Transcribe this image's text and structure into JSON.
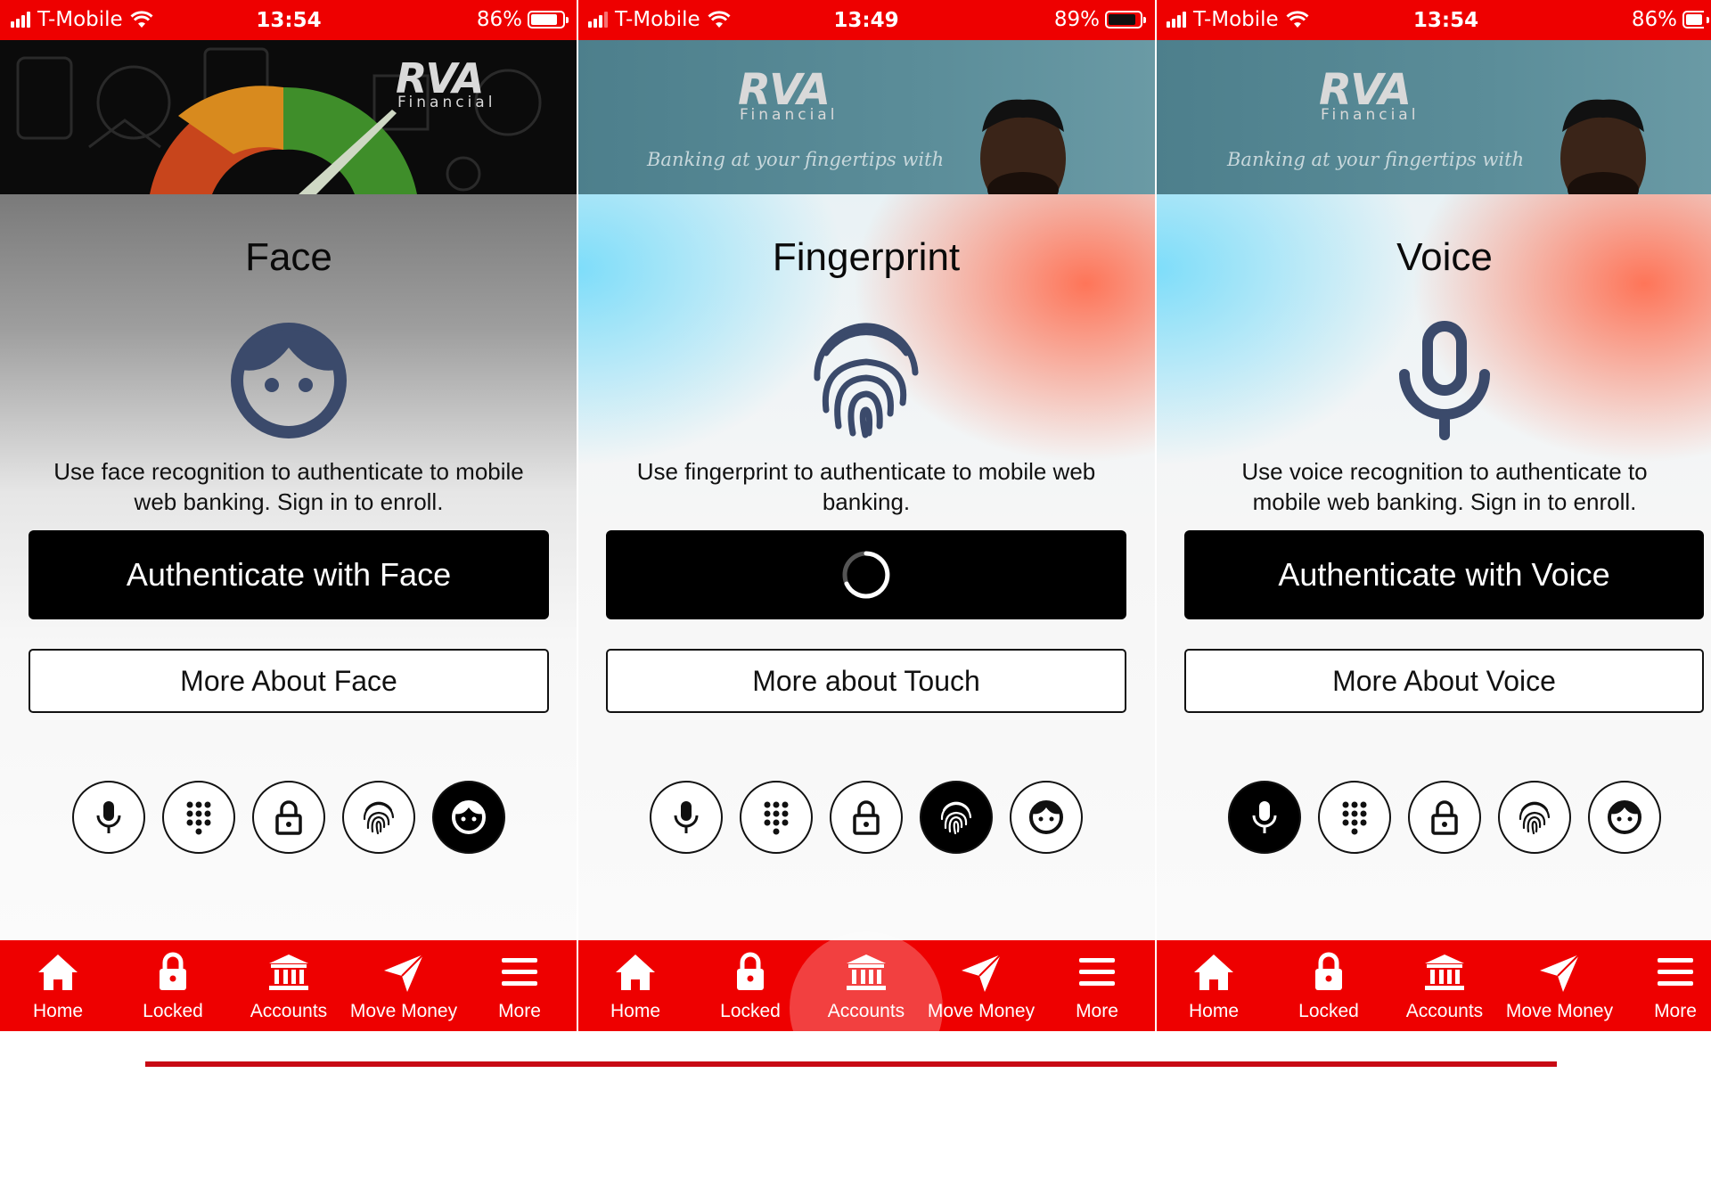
{
  "colors": {
    "brand_red": "#ee0000",
    "icon_navy": "#3b4a6b",
    "divider": "#c80a14"
  },
  "tabs": [
    {
      "label": "Home",
      "icon": "home-icon"
    },
    {
      "label": "Locked",
      "icon": "lock-icon"
    },
    {
      "label": "Accounts",
      "icon": "bank-icon"
    },
    {
      "label": "Move Money",
      "icon": "paper-plane-icon"
    },
    {
      "label": "More",
      "icon": "menu-icon"
    }
  ],
  "phones": [
    {
      "status": {
        "carrier": "T-Mobile",
        "time": "13:54",
        "battery": "86%",
        "battery_level": 0.86
      },
      "banner": {
        "logo": "RVA",
        "logo_sub": "Financial",
        "tagline": ""
      },
      "title": "Face",
      "hero_icon": "face-icon",
      "description": "Use face recognition to authenticate to mobile web banking. Sign in to enroll.",
      "primary_label": "Authenticate with Face",
      "primary_loading": false,
      "secondary_label": "More About Face",
      "active_method": "face"
    },
    {
      "status": {
        "carrier": "T-Mobile",
        "time": "13:49",
        "battery": "89%",
        "battery_level": 0.89
      },
      "banner": {
        "logo": "RVA",
        "logo_sub": "Financial",
        "tagline": "Banking at your fingertips with"
      },
      "title": "Fingerprint",
      "hero_icon": "fingerprint-icon",
      "description": "Use fingerprint to authenticate to mobile web banking.",
      "primary_label": "",
      "primary_loading": true,
      "secondary_label": "More about Touch",
      "active_method": "fingerprint"
    },
    {
      "status": {
        "carrier": "T-Mobile",
        "time": "13:54",
        "battery": "86%",
        "battery_level": 0.86
      },
      "banner": {
        "logo": "RVA",
        "logo_sub": "Financial",
        "tagline": "Banking at your fingertips with"
      },
      "title": "Voice",
      "hero_icon": "microphone-icon",
      "description": "Use voice recognition to authenticate to mobile web banking. Sign in to enroll.",
      "primary_label": "Authenticate with Voice",
      "primary_loading": false,
      "secondary_label": "More About Voice",
      "active_method": "voice"
    }
  ],
  "methods": [
    {
      "id": "voice",
      "icon": "microphone-icon"
    },
    {
      "id": "pin",
      "icon": "keypad-icon"
    },
    {
      "id": "password",
      "icon": "lock-icon"
    },
    {
      "id": "fingerprint",
      "icon": "fingerprint-icon"
    },
    {
      "id": "face",
      "icon": "face-icon"
    }
  ]
}
